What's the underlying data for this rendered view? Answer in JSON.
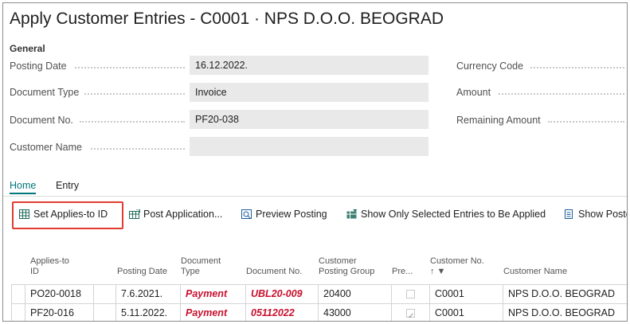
{
  "title": "Apply Customer Entries - C0001 · NPS D.O.O. BEOGRAD",
  "general": {
    "section": "General",
    "posting_date_label": "Posting Date",
    "posting_date": "16.12.2022.",
    "document_type_label": "Document Type",
    "document_type": "Invoice",
    "document_no_label": "Document No.",
    "document_no": "PF20-038",
    "customer_name_label": "Customer Name",
    "customer_name": "",
    "currency_code_label": "Currency Code",
    "amount_label": "Amount",
    "remaining_amount_label": "Remaining Amount"
  },
  "tabs": [
    "Home",
    "Entry"
  ],
  "actions": {
    "set_applies_to_id": "Set Applies-to ID",
    "post_application": "Post Application...",
    "preview_posting": "Preview Posting",
    "show_selected": "Show Only Selected Entries to Be Applied",
    "show_posted": "Show Poste"
  },
  "table": {
    "headers": {
      "applies_to_id_1": "Applies-to",
      "applies_to_id_2": "ID",
      "posting_date": "Posting Date",
      "document_type_1": "Document",
      "document_type_2": "Type",
      "document_no": "Document No.",
      "customer_posting_group_1": "Customer",
      "customer_posting_group_2": "Posting Group",
      "prepayment": "Pre...",
      "customer_no": "Customer No.",
      "customer_no_sort": "↑ ▼",
      "customer_name": "Customer Name"
    },
    "rows": [
      {
        "applies_to_id": "PO20-0018",
        "posting_date": "7.6.2021.",
        "document_type": "Payment",
        "document_no": "UBL20-009",
        "posting_group": "20400",
        "prepayment_checked": false,
        "customer_no": "C0001",
        "customer_name": "NPS D.O.O. BEOGRAD"
      },
      {
        "applies_to_id": "PF20-016",
        "posting_date": "5.11.2022.",
        "document_type": "Payment",
        "document_no": "05112022",
        "posting_group": "43000",
        "prepayment_checked": true,
        "customer_no": "C0001",
        "customer_name": "NPS D.O.O. BEOGRAD"
      }
    ]
  },
  "colors": {
    "accent": "#00777a",
    "highlight": "#e03c31",
    "negative_text": "#c8102e",
    "field_bg": "#e9e9e9"
  }
}
